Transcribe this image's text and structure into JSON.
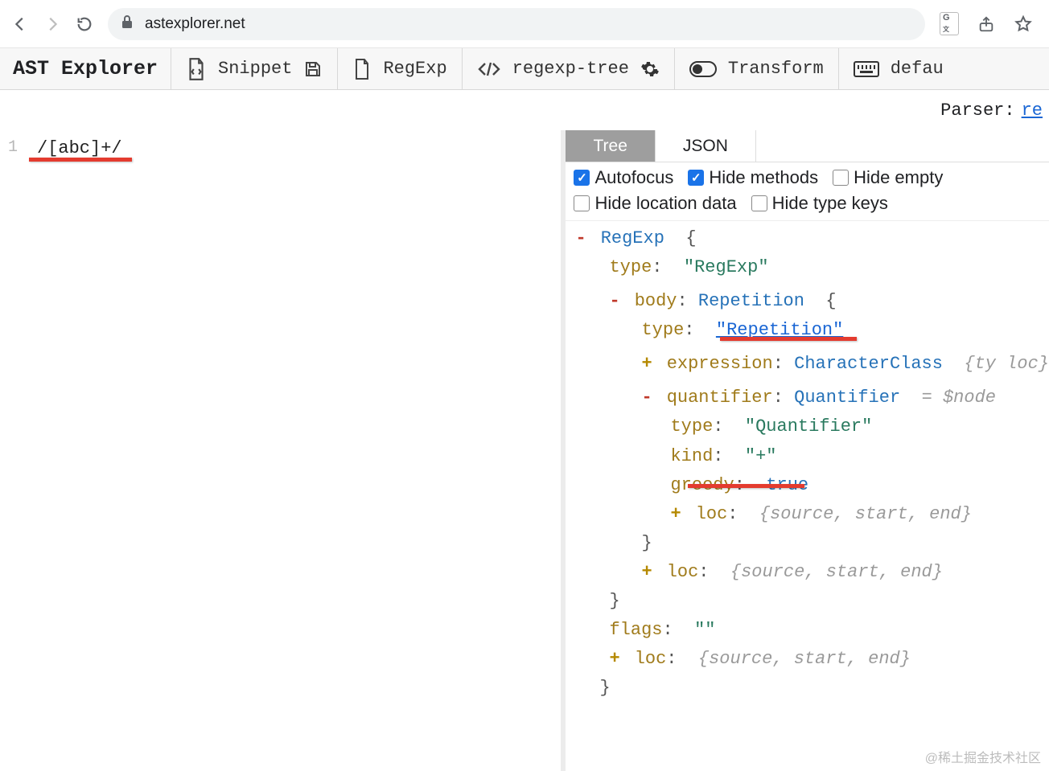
{
  "browser": {
    "url": "astexplorer.net"
  },
  "header": {
    "logo": "AST Explorer",
    "snippet": "Snippet",
    "language": "RegExp",
    "parser": "regexp-tree",
    "transform": "Transform",
    "keymap": "defau"
  },
  "parserLine": {
    "label": "Parser:",
    "link": "re"
  },
  "editor": {
    "lineNumber": "1",
    "code": "/[abc]+/"
  },
  "tabs": {
    "tree": "Tree",
    "json": "JSON"
  },
  "options": {
    "autofocus": "Autofocus",
    "hideMethods": "Hide methods",
    "hideEmpty": "Hide empty",
    "hideLocation": "Hide location data",
    "hideTypeKeys": "Hide type keys"
  },
  "ast": {
    "root": "RegExp",
    "rootTypeKey": "type",
    "rootTypeVal": "\"RegExp\"",
    "bodyKey": "body",
    "bodyType": "Repetition",
    "bodyTypeKey": "type",
    "bodyTypeVal": "\"Repetition\"",
    "exprKey": "expression",
    "exprType": "CharacterClass",
    "exprSummary": "{ty loc}",
    "quantKey": "quantifier",
    "quantType": "Quantifier",
    "quantNote": "= $node",
    "quantTypeKey": "type",
    "quantTypeVal": "\"Quantifier\"",
    "kindKey": "kind",
    "kindVal": "\"+\"",
    "greedyKey": "greedy",
    "greedyVal": "true",
    "locKey": "loc",
    "locSummary": "{source, start, end}",
    "flagsKey": "flags",
    "flagsVal": "\"\""
  },
  "watermark": "@稀土掘金技术社区"
}
